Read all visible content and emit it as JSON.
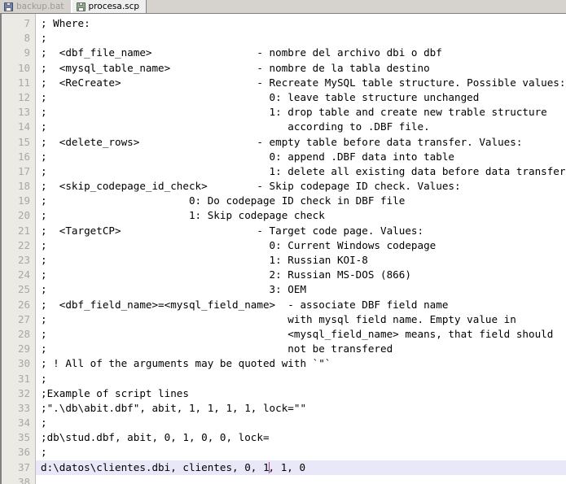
{
  "tabs": [
    {
      "label": "backup.bat",
      "icon": "floppy-disk-icon",
      "active": false
    },
    {
      "label": "procesa.scp",
      "icon": "floppy-disk-icon",
      "active": true
    }
  ],
  "editor": {
    "first_line_number": 7,
    "current_line_number": 37,
    "caret_column": 37,
    "current_line_highlight_color": "#e8e8f8",
    "caret_color": "#a04090",
    "gutter_color": "#eceae4",
    "line_number_color": "#a8a8a4",
    "lines": [
      {
        "n": 7,
        "text": "; Where:"
      },
      {
        "n": 8,
        "text": ";"
      },
      {
        "n": 9,
        "text": ";  <dbf_file_name>                 - nombre del archivo dbi o dbf"
      },
      {
        "n": 10,
        "text": ";  <mysql_table_name>              - nombre de la tabla destino"
      },
      {
        "n": 11,
        "text": ";  <ReCreate>                      - Recreate MySQL table structure. Possible values:"
      },
      {
        "n": 12,
        "text": ";                                    0: leave table structure unchanged"
      },
      {
        "n": 13,
        "text": ";                                    1: drop table and create new trable structure"
      },
      {
        "n": 14,
        "text": ";                                       according to .DBF file."
      },
      {
        "n": 15,
        "text": ";  <delete_rows>                   - empty table before data transfer. Values:"
      },
      {
        "n": 16,
        "text": ";                                    0: append .DBF data into table"
      },
      {
        "n": 17,
        "text": ";                                    1: delete all existing data before data transfer"
      },
      {
        "n": 18,
        "text": ";  <skip_codepage_id_check>        - Skip codepage ID check. Values:"
      },
      {
        "n": 19,
        "text": ";                       0: Do codepage ID check in DBF file"
      },
      {
        "n": 20,
        "text": ";                       1: Skip codepage check"
      },
      {
        "n": 21,
        "text": ";  <TargetCP>                      - Target code page. Values:"
      },
      {
        "n": 22,
        "text": ";                                    0: Current Windows codepage"
      },
      {
        "n": 23,
        "text": ";                                    1: Russian KOI-8"
      },
      {
        "n": 24,
        "text": ";                                    2: Russian MS-DOS (866)"
      },
      {
        "n": 25,
        "text": ";                                    3: OEM"
      },
      {
        "n": 26,
        "text": ";  <dbf_field_name>=<mysql_field_name>  - associate DBF field name"
      },
      {
        "n": 27,
        "text": ";                                       with mysql field name. Empty value in"
      },
      {
        "n": 28,
        "text": ";                                       <mysql_field_name> means, that field should"
      },
      {
        "n": 29,
        "text": ";                                       not be transfered"
      },
      {
        "n": 30,
        "text": "; ! All of the arguments may be quoted with `\"`"
      },
      {
        "n": 31,
        "text": ";"
      },
      {
        "n": 32,
        "text": ";Example of script lines"
      },
      {
        "n": 33,
        "text": ";\".\\db\\abit.dbf\", abit, 1, 1, 1, 1, lock=\"\""
      },
      {
        "n": 34,
        "text": ";"
      },
      {
        "n": 35,
        "text": ";db\\stud.dbf, abit, 0, 1, 0, 0, lock="
      },
      {
        "n": 36,
        "text": ";"
      },
      {
        "n": 37,
        "text": "d:\\datos\\clientes.dbi, clientes, 0, 1, 1, 0"
      },
      {
        "n": 38,
        "text": ""
      }
    ]
  }
}
